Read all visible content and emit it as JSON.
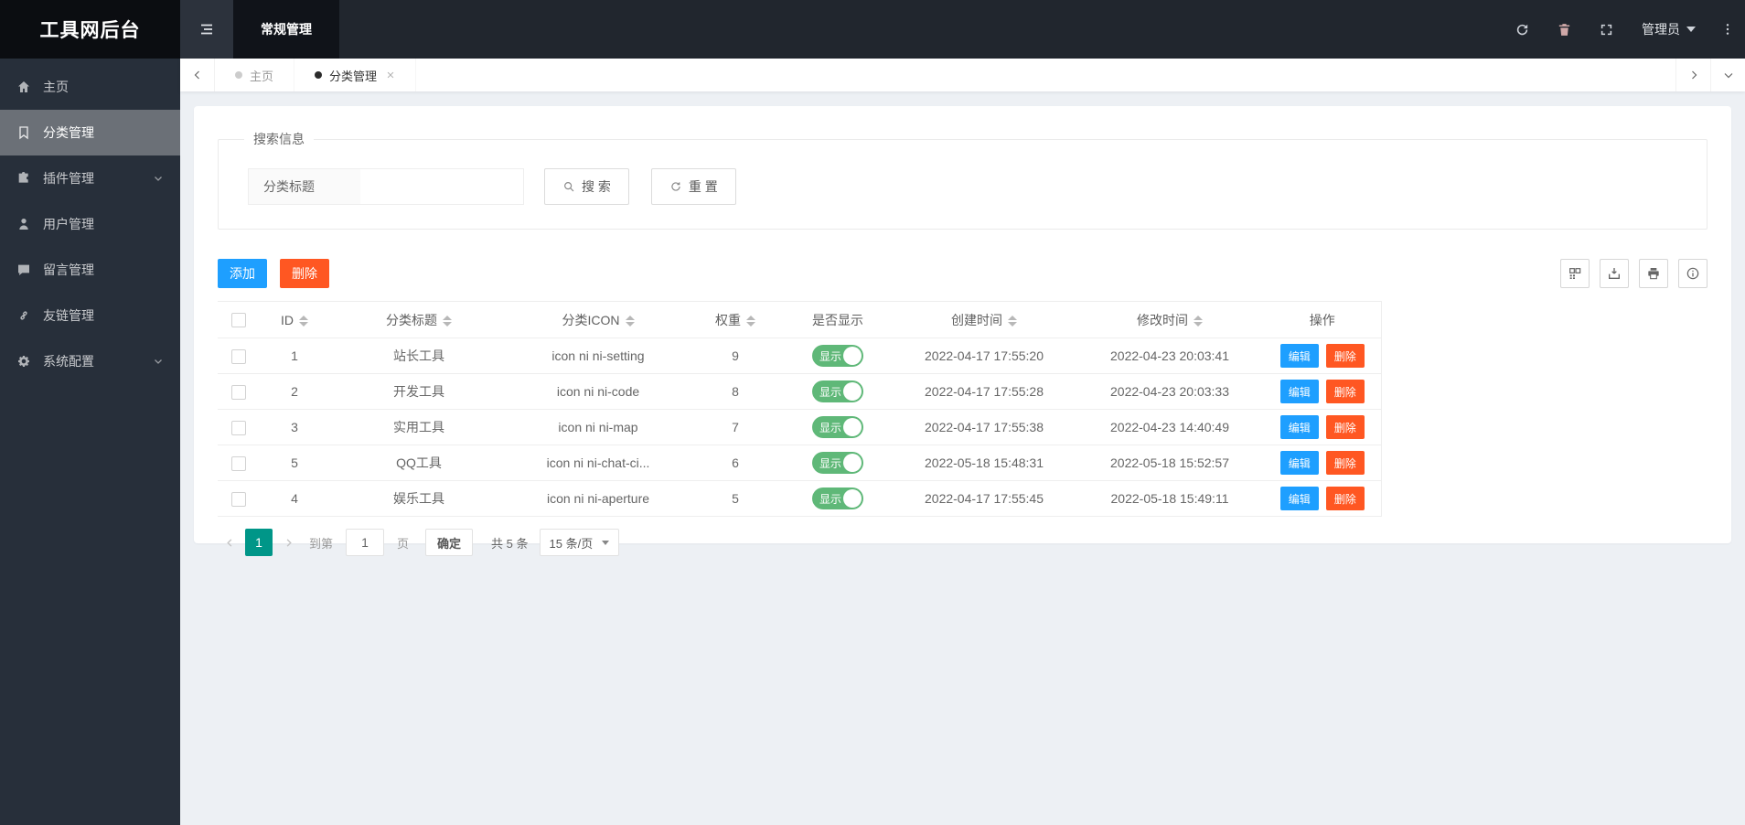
{
  "colors": {
    "primary_blue": "#1E9FFF",
    "danger_orange": "#FF5722",
    "toggle_green": "#5FB878",
    "pagination_active_green": "#009688",
    "sidebar_dark": "#272f3a",
    "topbar_dark": "#21262e"
  },
  "app": {
    "logo_title": "工具网后台"
  },
  "topbar": {
    "nav_tab": "常规管理",
    "admin_label": "管理员"
  },
  "tabbar": {
    "tabs": [
      {
        "label": "主页"
      },
      {
        "label": "分类管理"
      }
    ]
  },
  "sidebar": {
    "items": [
      {
        "label": "主页"
      },
      {
        "label": "分类管理"
      },
      {
        "label": "插件管理"
      },
      {
        "label": "用户管理"
      },
      {
        "label": "留言管理"
      },
      {
        "label": "友链管理"
      },
      {
        "label": "系统配置"
      }
    ]
  },
  "search_panel": {
    "legend": "搜索信息",
    "field_label": "分类标题",
    "search_button": "搜 索",
    "reset_button": "重 置"
  },
  "table_toolbar": {
    "add_button": "添加",
    "delete_button": "删除"
  },
  "table": {
    "headers": {
      "id": "ID",
      "title": "分类标题",
      "icon": "分类ICON",
      "weight": "权重",
      "show": "是否显示",
      "created": "创建时间",
      "modified": "修改时间",
      "actions": "操作"
    },
    "toggle_on_label": "显示",
    "action_edit": "编辑",
    "action_delete": "删除",
    "rows": [
      {
        "id": "1",
        "title": "站长工具",
        "icon": "icon ni ni-setting",
        "weight": "9",
        "created": "2022-04-17 17:55:20",
        "modified": "2022-04-23 20:03:41"
      },
      {
        "id": "2",
        "title": "开发工具",
        "icon": "icon ni ni-code",
        "weight": "8",
        "created": "2022-04-17 17:55:28",
        "modified": "2022-04-23 20:03:33"
      },
      {
        "id": "3",
        "title": "实用工具",
        "icon": "icon ni ni-map",
        "weight": "7",
        "created": "2022-04-17 17:55:38",
        "modified": "2022-04-23 14:40:49"
      },
      {
        "id": "5",
        "title": "QQ工具",
        "icon": "icon ni ni-chat-ci...",
        "weight": "6",
        "created": "2022-05-18 15:48:31",
        "modified": "2022-05-18 15:52:57"
      },
      {
        "id": "4",
        "title": "娱乐工具",
        "icon": "icon ni ni-aperture",
        "weight": "5",
        "created": "2022-04-17 17:55:45",
        "modified": "2022-05-18 15:49:11"
      }
    ]
  },
  "pagination": {
    "current_page": "1",
    "goto_prefix": "到第",
    "goto_value": "1",
    "goto_suffix": "页",
    "confirm_button": "确定",
    "total_text": "共 5 条",
    "per_page": "15 条/页"
  }
}
